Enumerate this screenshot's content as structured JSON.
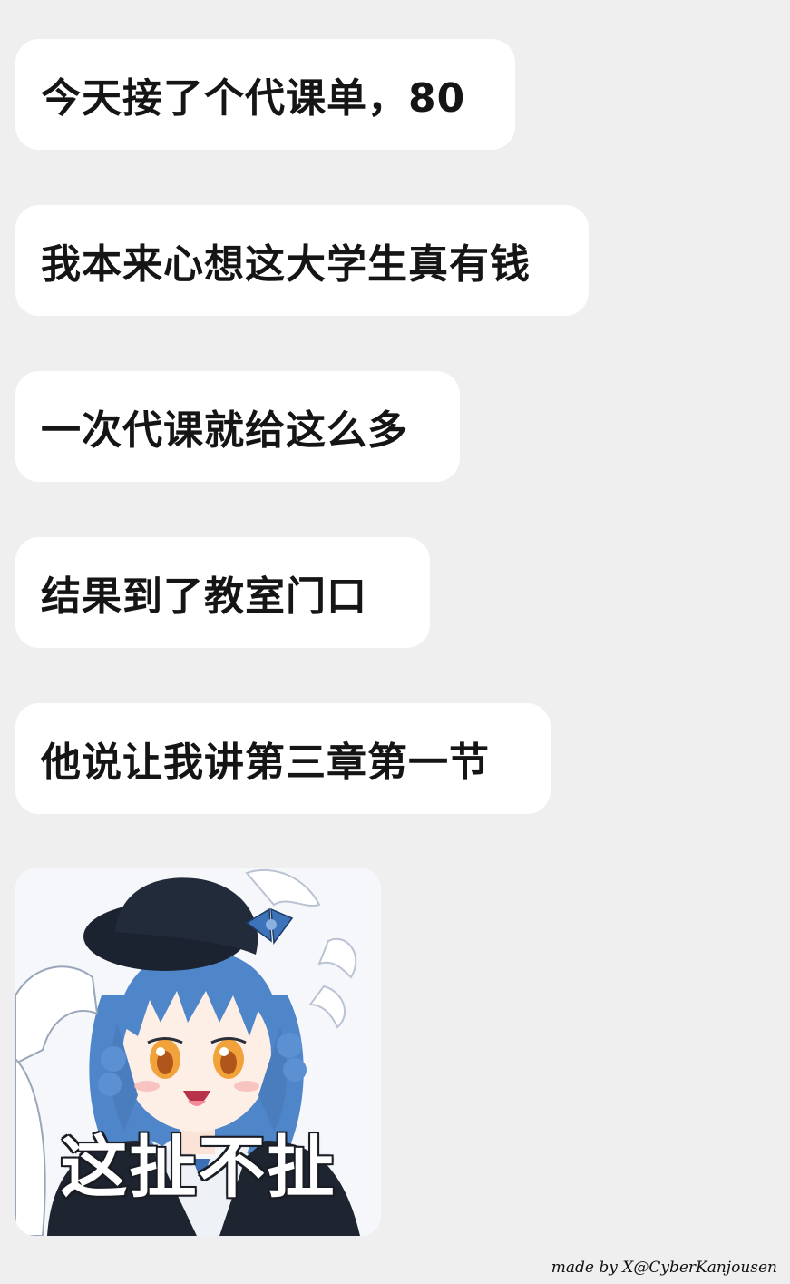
{
  "messages": [
    {
      "text": "今天接了个代课单，80"
    },
    {
      "text": "我本来心想这大学生真有钱"
    },
    {
      "text": "一次代课就给这么多"
    },
    {
      "text": "结果到了教室门口"
    },
    {
      "text": "他说让我讲第三章第一节"
    }
  ],
  "sticker": {
    "caption": "这扯不扯",
    "icon": "anime-girl-blue-hair-sticker"
  },
  "watermark": "made by X@CyberKanjousen",
  "colors": {
    "background": "#efeff0",
    "bubble": "#ffffff",
    "text": "#151515",
    "hair": "#4f86c9",
    "hat": "#1b2230"
  }
}
